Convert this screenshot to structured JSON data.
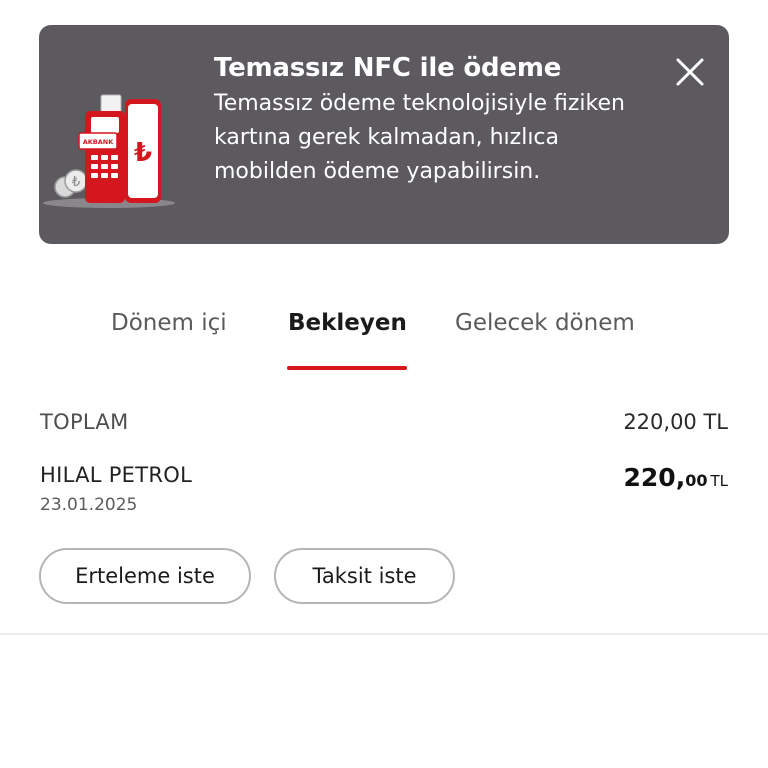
{
  "banner": {
    "title": "Temassız NFC ile ödeme",
    "body": "Temassız ödeme teknolojisiyle fiziken kartına gerek kalmadan, hızlıca mobilden ödeme yapabilirsin.",
    "close_icon": "close-icon",
    "illustration_card_text": "AKBANK",
    "illustration_symbol": "₺",
    "background_color": "#5d5a5f"
  },
  "tabs": [
    {
      "label": "Dönem içi",
      "active": false
    },
    {
      "label": "Bekleyen",
      "active": true
    },
    {
      "label": "Gelecek dönem",
      "active": false
    }
  ],
  "accent_color": "#d4161f",
  "summary": {
    "total_label": "TOPLAM",
    "total_value": "220,00 TL"
  },
  "transaction": {
    "merchant": "HILAL PETROL",
    "date": "23.01.2025",
    "amount_integer": "220,",
    "amount_decimal": "00",
    "currency": "TL"
  },
  "actions": {
    "defer_label": "Erteleme iste",
    "installment_label": "Taksit iste"
  }
}
